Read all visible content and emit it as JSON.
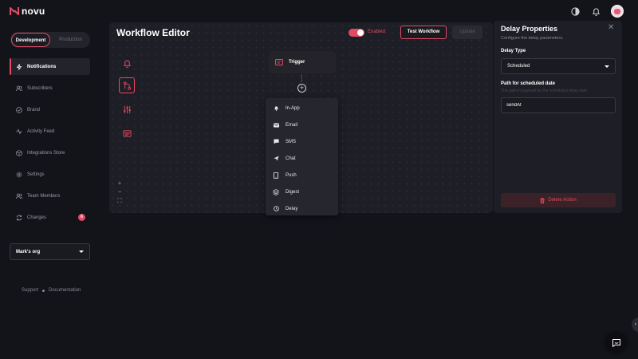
{
  "app": {
    "name": "novu"
  },
  "environment": {
    "options": [
      "Development",
      "Production"
    ],
    "active": "Development"
  },
  "sidebar": {
    "items": [
      {
        "label": "Notifications",
        "icon": "bolt-icon",
        "active": true
      },
      {
        "label": "Subscribers",
        "icon": "users-icon"
      },
      {
        "label": "Brand",
        "icon": "check-circle-icon"
      },
      {
        "label": "Activity Feed",
        "icon": "activity-icon"
      },
      {
        "label": "Integrations Store",
        "icon": "box-icon"
      },
      {
        "label": "Settings",
        "icon": "gear-icon"
      },
      {
        "label": "Team Members",
        "icon": "team-icon"
      },
      {
        "label": "Changes",
        "icon": "sync-icon",
        "badge": "6"
      }
    ],
    "org": "Mark's org",
    "footer": {
      "support": "Support",
      "documentation": "Documentation"
    }
  },
  "editor": {
    "title": "Workflow Editor",
    "toggle_label": "Enabled",
    "test_button": "Test Workflow",
    "update_button": "Update",
    "trigger_label": "Trigger",
    "steps": [
      {
        "label": "In-App",
        "icon": "bell-icon"
      },
      {
        "label": "Email",
        "icon": "mail-icon"
      },
      {
        "label": "SMS",
        "icon": "sms-icon"
      },
      {
        "label": "Chat",
        "icon": "send-icon"
      },
      {
        "label": "Push",
        "icon": "phone-icon"
      },
      {
        "label": "Digest",
        "icon": "layers-icon"
      },
      {
        "label": "Delay",
        "icon": "clock-icon"
      }
    ],
    "zoom": {
      "in": "+",
      "out": "−",
      "fit": "⛶"
    }
  },
  "panel": {
    "title": "Delay Properties",
    "subtitle": "Configure the delay parameters.",
    "delay_type_label": "Delay Type",
    "delay_type_value": "Scheduled",
    "path_label": "Path for scheduled date",
    "path_desc": "The path in payload for the scheduled delay date",
    "path_value": "sendAt",
    "delete_label": "Delete Action"
  },
  "colors": {
    "accent": "#e34b63",
    "background": "#13131a",
    "surface": "#1e1e26"
  }
}
